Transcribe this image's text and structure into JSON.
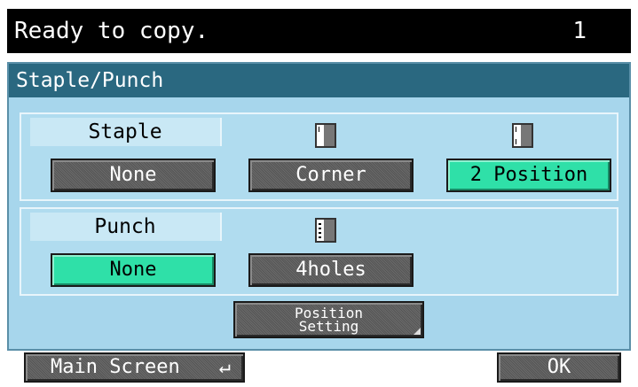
{
  "status": {
    "message": "Ready to copy.",
    "copies": "1"
  },
  "panel": {
    "title": "Staple/Punch"
  },
  "staple": {
    "label": "Staple",
    "options": [
      "None",
      "Corner",
      "2 Position"
    ],
    "selected": "2 Position"
  },
  "punch": {
    "label": "Punch",
    "options": [
      "None",
      "4holes"
    ],
    "selected": "None"
  },
  "position_setting": {
    "line1": "Position",
    "line2": "Setting"
  },
  "footer": {
    "main_screen_label": "Main Screen",
    "ok_label": "OK"
  },
  "colors": {
    "selected": "#2fe0a8",
    "panel_bg": "#a7d6ec",
    "title_bar": "#2a6880"
  },
  "icons": [
    "document-corner-staple-icon",
    "document-two-position-staple-icon",
    "document-punch-holes-icon",
    "return-arrow-icon"
  ]
}
